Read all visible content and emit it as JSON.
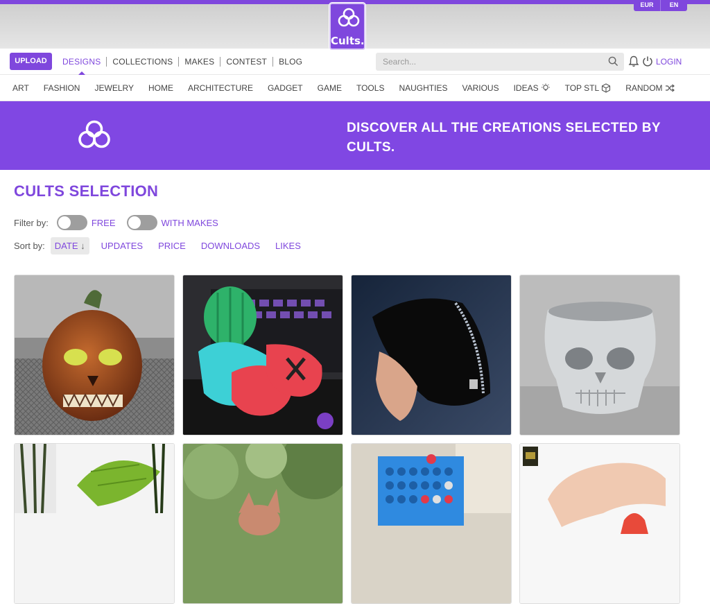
{
  "header": {
    "logo_text": "Cults.",
    "currency": "EUR",
    "language": "EN"
  },
  "nav": {
    "upload": "UPLOAD",
    "items": [
      "DESIGNS",
      "COLLECTIONS",
      "MAKES",
      "CONTEST",
      "BLOG"
    ],
    "active": "DESIGNS",
    "search_placeholder": "Search...",
    "login": "LOGIN"
  },
  "categories": [
    "ART",
    "FASHION",
    "JEWELRY",
    "HOME",
    "ARCHITECTURE",
    "GADGET",
    "GAME",
    "TOOLS",
    "NAUGHTIES",
    "VARIOUS",
    "IDEAS",
    "TOP STL",
    "RANDOM"
  ],
  "banner": {
    "text": "DISCOVER ALL THE CREATIONS SELECTED BY CULTS."
  },
  "page": {
    "title": "CULTS SELECTION",
    "filter_label": "Filter by:",
    "filters": [
      "FREE",
      "WITH MAKES"
    ],
    "sort_label": "Sort by:",
    "sort_options": [
      "DATE",
      "UPDATES",
      "PRICE",
      "DOWNLOADS",
      "LIKES"
    ],
    "sort_active": "DATE"
  },
  "colors": {
    "accent": "#7f47dd"
  },
  "cards": [
    {
      "subject": "pumpkin-skull"
    },
    {
      "subject": "cactus-toys"
    },
    {
      "subject": "zip-pouch"
    },
    {
      "subject": "skull-planter"
    },
    {
      "subject": "plant-pot"
    },
    {
      "subject": "garden-figure"
    },
    {
      "subject": "connect-four"
    },
    {
      "subject": "hand-toy"
    }
  ]
}
